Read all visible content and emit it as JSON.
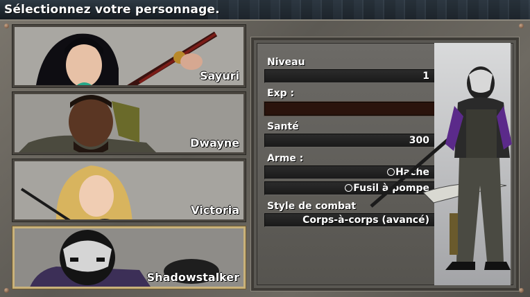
{
  "header": {
    "title": "Sélectionnez votre personnage."
  },
  "characters": [
    {
      "name": "Sayuri"
    },
    {
      "name": "Dwayne"
    },
    {
      "name": "Victoria"
    },
    {
      "name": "Shadowstalker",
      "selected": true
    }
  ],
  "stats": {
    "level_label": "Niveau",
    "level_value": "1",
    "exp_label": "Exp :",
    "exp_fill": 0,
    "health_label": "Santé",
    "health_value": "300",
    "weapon_label": "Arme :",
    "weapons": [
      "Hache",
      "Fusil à pompe"
    ],
    "style_label": "Style de combat",
    "style_value": "Corps-à-corps (avancé)"
  },
  "colors": {
    "selected_border": "#c9b27a",
    "exp_bar": "#2a130c"
  }
}
